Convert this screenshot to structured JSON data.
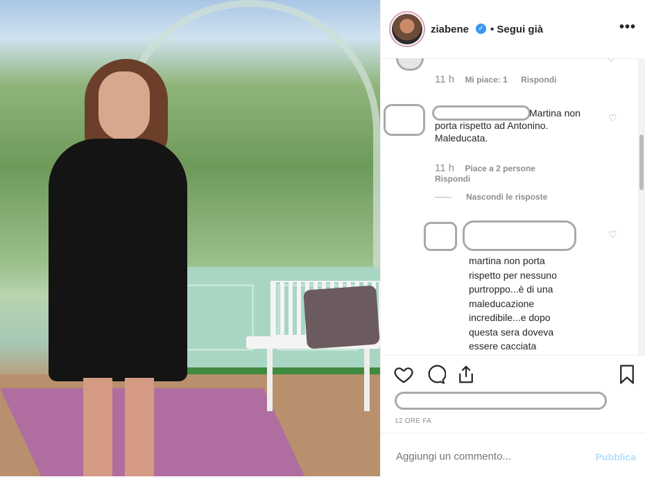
{
  "post": {
    "photo_alt": "",
    "header": {
      "username": "ziabene",
      "verified_glyph": "✓",
      "follow_label": "• Segui già",
      "more_label": "•••"
    },
    "comments": [
      {
        "time": "11 h",
        "likes": "Mi piace: 1",
        "reply": "Rispondi"
      },
      {
        "text": "Martina non porta rispetto ad Antonino. Maleducata.",
        "time": "11 h",
        "likes": "Piace a 2 persone",
        "reply": "Rispondi",
        "hide_replies": "Nascondi le risposte",
        "reply_comment": {
          "text": "martina non porta rispetto per nessuno purtroppo...è di una maleducazione incredibile...e dopo questa sera doveva essere cacciata"
        }
      }
    ],
    "actions": {
      "like_icon": "heart-icon",
      "comment_icon": "comment-icon",
      "share_icon": "share-icon",
      "save_icon": "bookmark-icon"
    },
    "date": "12 ORE FA",
    "add_comment": {
      "placeholder": "Aggiungi un commento...",
      "publish_label": "Pubblica"
    },
    "colors": {
      "link": "#3897f0",
      "publish_disabled": "#b2dffc",
      "muted": "#8e8e8e"
    }
  }
}
